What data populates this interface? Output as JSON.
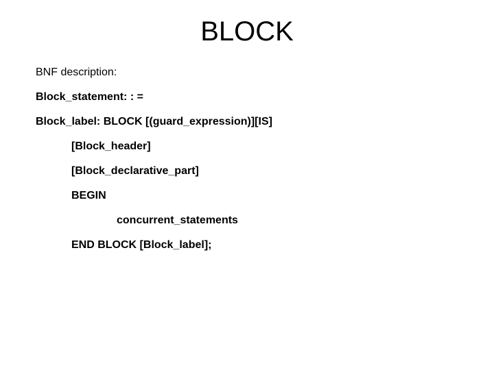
{
  "title": "BLOCK",
  "descLabel": "BNF description:",
  "line1": "Block_statement: : =",
  "line2": "Block_label: BLOCK [(guard_expression)][IS]",
  "indented": {
    "l1": "[Block_header]",
    "l2": "[Block_declarative_part]",
    "l3": "BEGIN",
    "l4": "concurrent_statements",
    "l5": "END BLOCK [Block_label];"
  }
}
